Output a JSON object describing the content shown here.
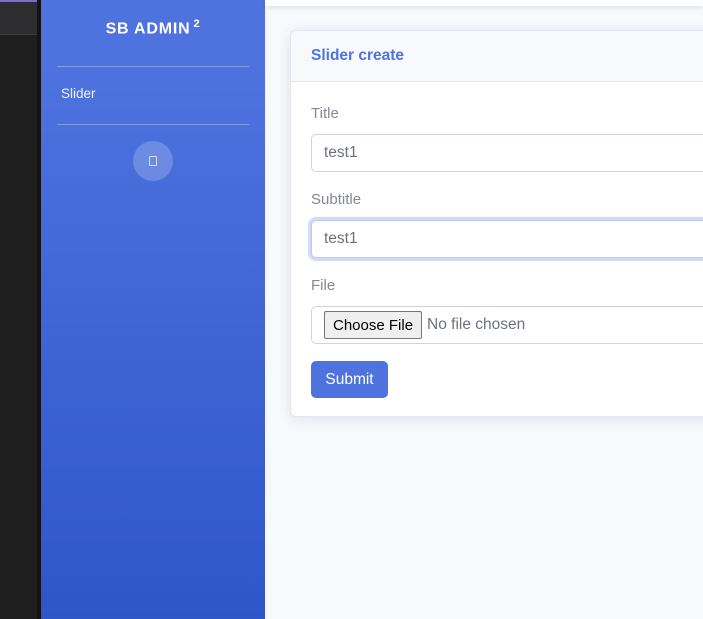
{
  "sidebar": {
    "brand": "SB ADMIN",
    "brand_sup": "2",
    "items": [
      {
        "label": "Slider"
      }
    ],
    "toggle_icon": "chevron-left-icon"
  },
  "card": {
    "title": "Slider create"
  },
  "form": {
    "title_label": "Title",
    "title_value": "test1",
    "subtitle_label": "Subtitle",
    "subtitle_value": "test1",
    "file_label": "File",
    "choose_file_label": "Choose File",
    "file_status": "No file chosen",
    "submit_label": "Submit"
  },
  "colors": {
    "primary": "#4e73df",
    "label": "#858796",
    "input_text": "#6e707e"
  }
}
